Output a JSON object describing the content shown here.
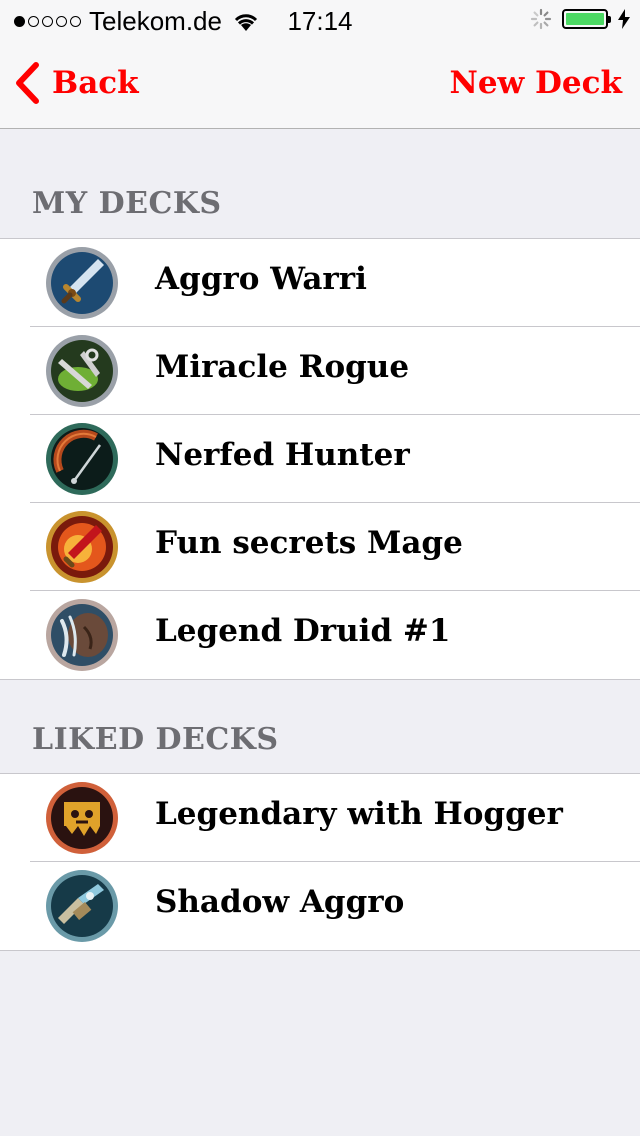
{
  "status_bar": {
    "carrier": "Telekom.de",
    "time": "17:14",
    "signal_icon": "signal-dots-icon",
    "wifi_icon": "wifi-icon",
    "activity_icon": "activity-spinner-icon",
    "battery_icon": "battery-icon",
    "battery_color": "#4cd964"
  },
  "nav": {
    "back_label": "Back",
    "new_deck_label": "New Deck",
    "accent_color": "#ff0000"
  },
  "sections": {
    "my_decks": {
      "title": "MY DECKS",
      "items": [
        {
          "name": "Aggro Warri",
          "icon": "sword-icon"
        },
        {
          "name": "Miracle Rogue",
          "icon": "daggers-icon"
        },
        {
          "name": "Nerfed Hunter",
          "icon": "bow-icon"
        },
        {
          "name": "Fun secrets Mage",
          "icon": "fire-staff-icon"
        },
        {
          "name": "Legend Druid #1",
          "icon": "claw-icon"
        }
      ]
    },
    "liked_decks": {
      "title": "LIKED DECKS",
      "items": [
        {
          "name": "Legendary with Hogger",
          "icon": "hogger-banner-icon"
        },
        {
          "name": "Shadow Aggro",
          "icon": "mechanical-icon"
        }
      ]
    }
  }
}
